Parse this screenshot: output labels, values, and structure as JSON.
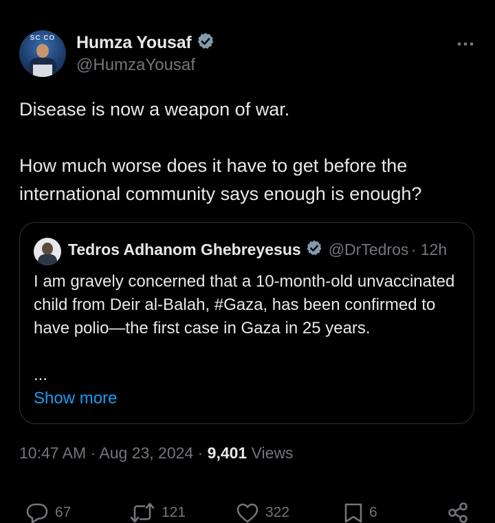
{
  "author": {
    "name": "Humza Yousaf",
    "handle": "@HumzaYousaf",
    "avatar_banner": "SC CO"
  },
  "tweet": {
    "line1": "Disease is now a weapon of war.",
    "line2": "How much worse does it have to get before the international community says enough is enough?"
  },
  "quote": {
    "name": "Tedros Adhanom Ghebreyesus",
    "handle": "@DrTedros",
    "time": "· 12h",
    "text": "I am gravely concerned that a 10-month-old unvaccinated child from Deir al-Balah, #Gaza, has been confirmed to have polio—the first case in Gaza in 25 years.",
    "ellipsis": "...",
    "show_more": "Show more"
  },
  "meta": {
    "time": "10:47 AM",
    "date": "Aug 23, 2024",
    "views_count": "9,401",
    "views_label": "Views",
    "sep": "·"
  },
  "actions": {
    "replies": "67",
    "reposts": "121",
    "likes": "322",
    "bookmarks": "6"
  },
  "colors": {
    "background": "#000000",
    "text": "#e7e9ea",
    "secondary": "#71767b",
    "link": "#1d9bf0",
    "verified": "#829aab",
    "border": "#2f3336"
  }
}
